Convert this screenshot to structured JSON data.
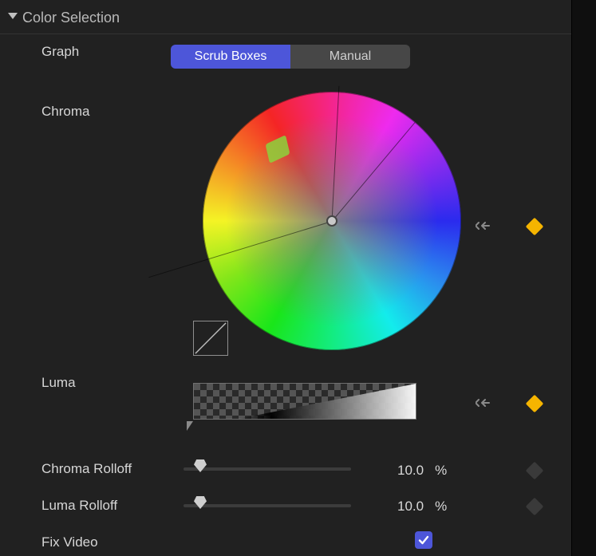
{
  "section": {
    "title": "Color Selection"
  },
  "graph": {
    "label": "Graph",
    "options": [
      "Scrub Boxes",
      "Manual"
    ],
    "selected": "Scrub Boxes"
  },
  "chroma": {
    "label": "Chroma"
  },
  "luma": {
    "label": "Luma"
  },
  "chroma_rolloff": {
    "label": "Chroma Rolloff",
    "value": "10.0",
    "unit": "%",
    "slider_min": 0,
    "slider_max": 100,
    "slider_value": 10
  },
  "luma_rolloff": {
    "label": "Luma Rolloff",
    "value": "10.0",
    "unit": "%",
    "slider_min": 0,
    "slider_max": 100,
    "slider_value": 10
  },
  "fix_video": {
    "label": "Fix Video",
    "checked": true
  },
  "icons": {
    "reset": "reset-arrow-icon",
    "keyframe": "keyframe-diamond-icon",
    "curve": "curve-icon",
    "disclosure": "disclosure-triangle-icon",
    "check": "checkmark-icon"
  }
}
